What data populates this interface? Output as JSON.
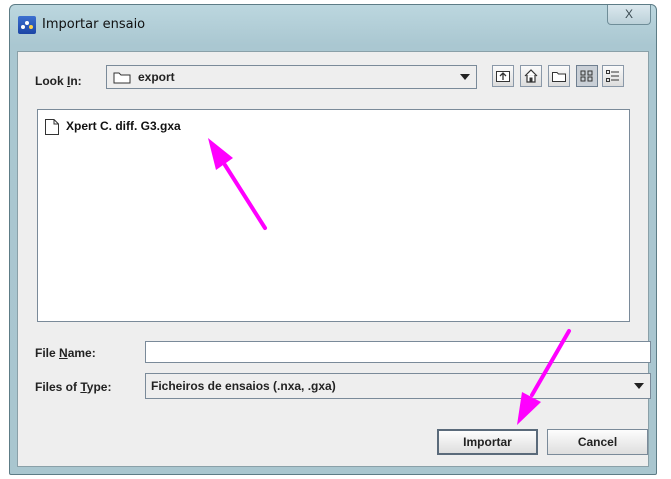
{
  "window": {
    "title": "Importar ensaio",
    "close_label": "X"
  },
  "look_in": {
    "label_prefix": "Look ",
    "label_underlined": "I",
    "label_suffix": "n:",
    "value": "export"
  },
  "toolbar": {
    "buttons": [
      "up-one-level-icon",
      "home-icon",
      "new-folder-icon",
      "list-view-icon",
      "details-view-icon"
    ],
    "active": "list-view-icon"
  },
  "files": [
    {
      "name": "Xpert C. diff. G3.gxa",
      "icon": "file-icon"
    }
  ],
  "file_name": {
    "label_prefix": "File ",
    "label_underlined": "N",
    "label_suffix": "ame:",
    "value": ""
  },
  "file_type": {
    "label_prefix": "Files of ",
    "label_underlined": "T",
    "label_suffix": "ype:",
    "value": "Ficheiros de ensaios (.nxa, .gxa)"
  },
  "buttons": {
    "import_label": "Importar",
    "cancel_label": "Cancel"
  },
  "annotation_color": "#ff00ff"
}
